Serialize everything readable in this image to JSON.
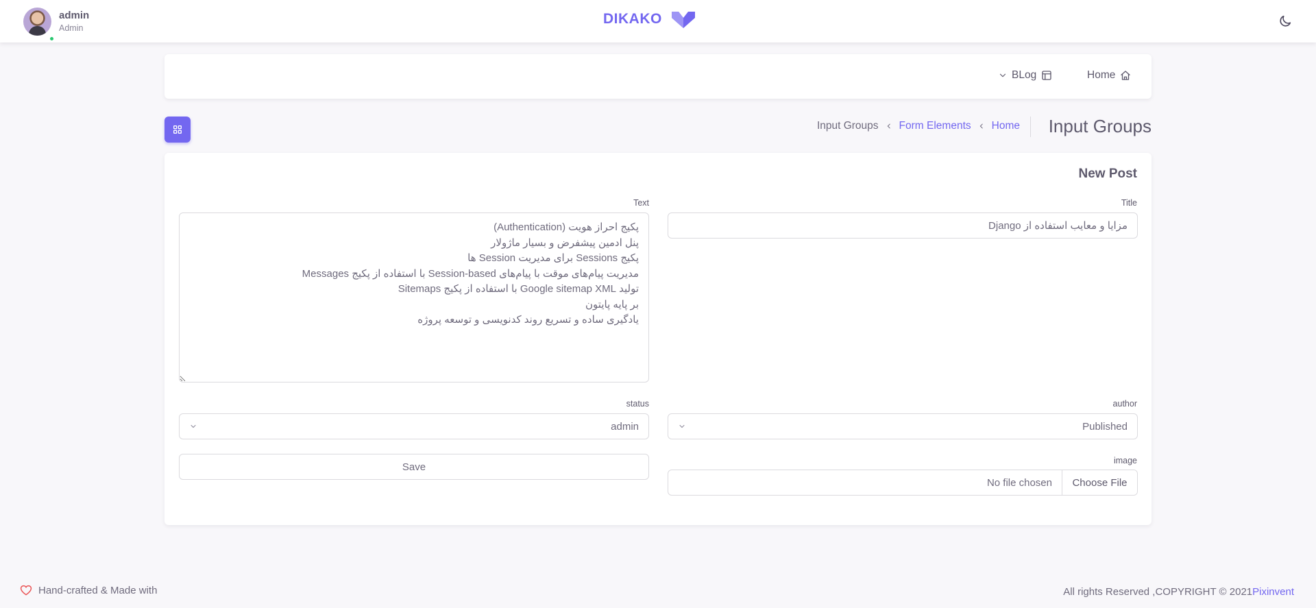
{
  "user": {
    "name": "admin",
    "role": "Admin"
  },
  "brand": {
    "name": "DIKAKO",
    "color": "#7367f0"
  },
  "menu": {
    "home_label": "Home",
    "blog_label": "BLog"
  },
  "breadcrumb": {
    "page_title": "Input Groups",
    "items": [
      "Home",
      "Form Elements",
      "Input Groups"
    ]
  },
  "form": {
    "card_title": "New Post",
    "title_label": "Title",
    "title_value": "مزایا و معایب استفاده از Django",
    "text_label": "Text",
    "text_value": "پکیج احراز هویت (Authentication)\nپنل ادمین پیشفرض و بسیار ماژولار\nپکیج Sessions برای مدیریت Session ها\nمدیریت پیام‌های موقت با پیام‌های Session-based با استفاده از پکیج Messages\nتولید Google sitemap XML با استفاده از پکیج Sitemaps\nبر پایه پایتون\nیادگیری ساده و تسریع روند کدنویسی و توسعه پروژه",
    "author_label": "author",
    "author_value": "Published",
    "status_label": "status",
    "status_value": "admin",
    "image_label": "image",
    "file_button": "Choose File",
    "file_status": "No file chosen",
    "save_label": "Save"
  },
  "footer": {
    "left_text": "Hand-crafted & Made with",
    "copyright": "All rights Reserved ,COPYRIGHT © 2021",
    "company": "Pixinvent"
  },
  "icons": {
    "home": "home-icon",
    "blog": "layout-icon",
    "theme": "moon-icon",
    "grid": "grid-icon",
    "heart": "heart-icon"
  },
  "colors": {
    "primary": "#7367f0",
    "success": "#28c76f",
    "background": "#f8f7fa"
  }
}
